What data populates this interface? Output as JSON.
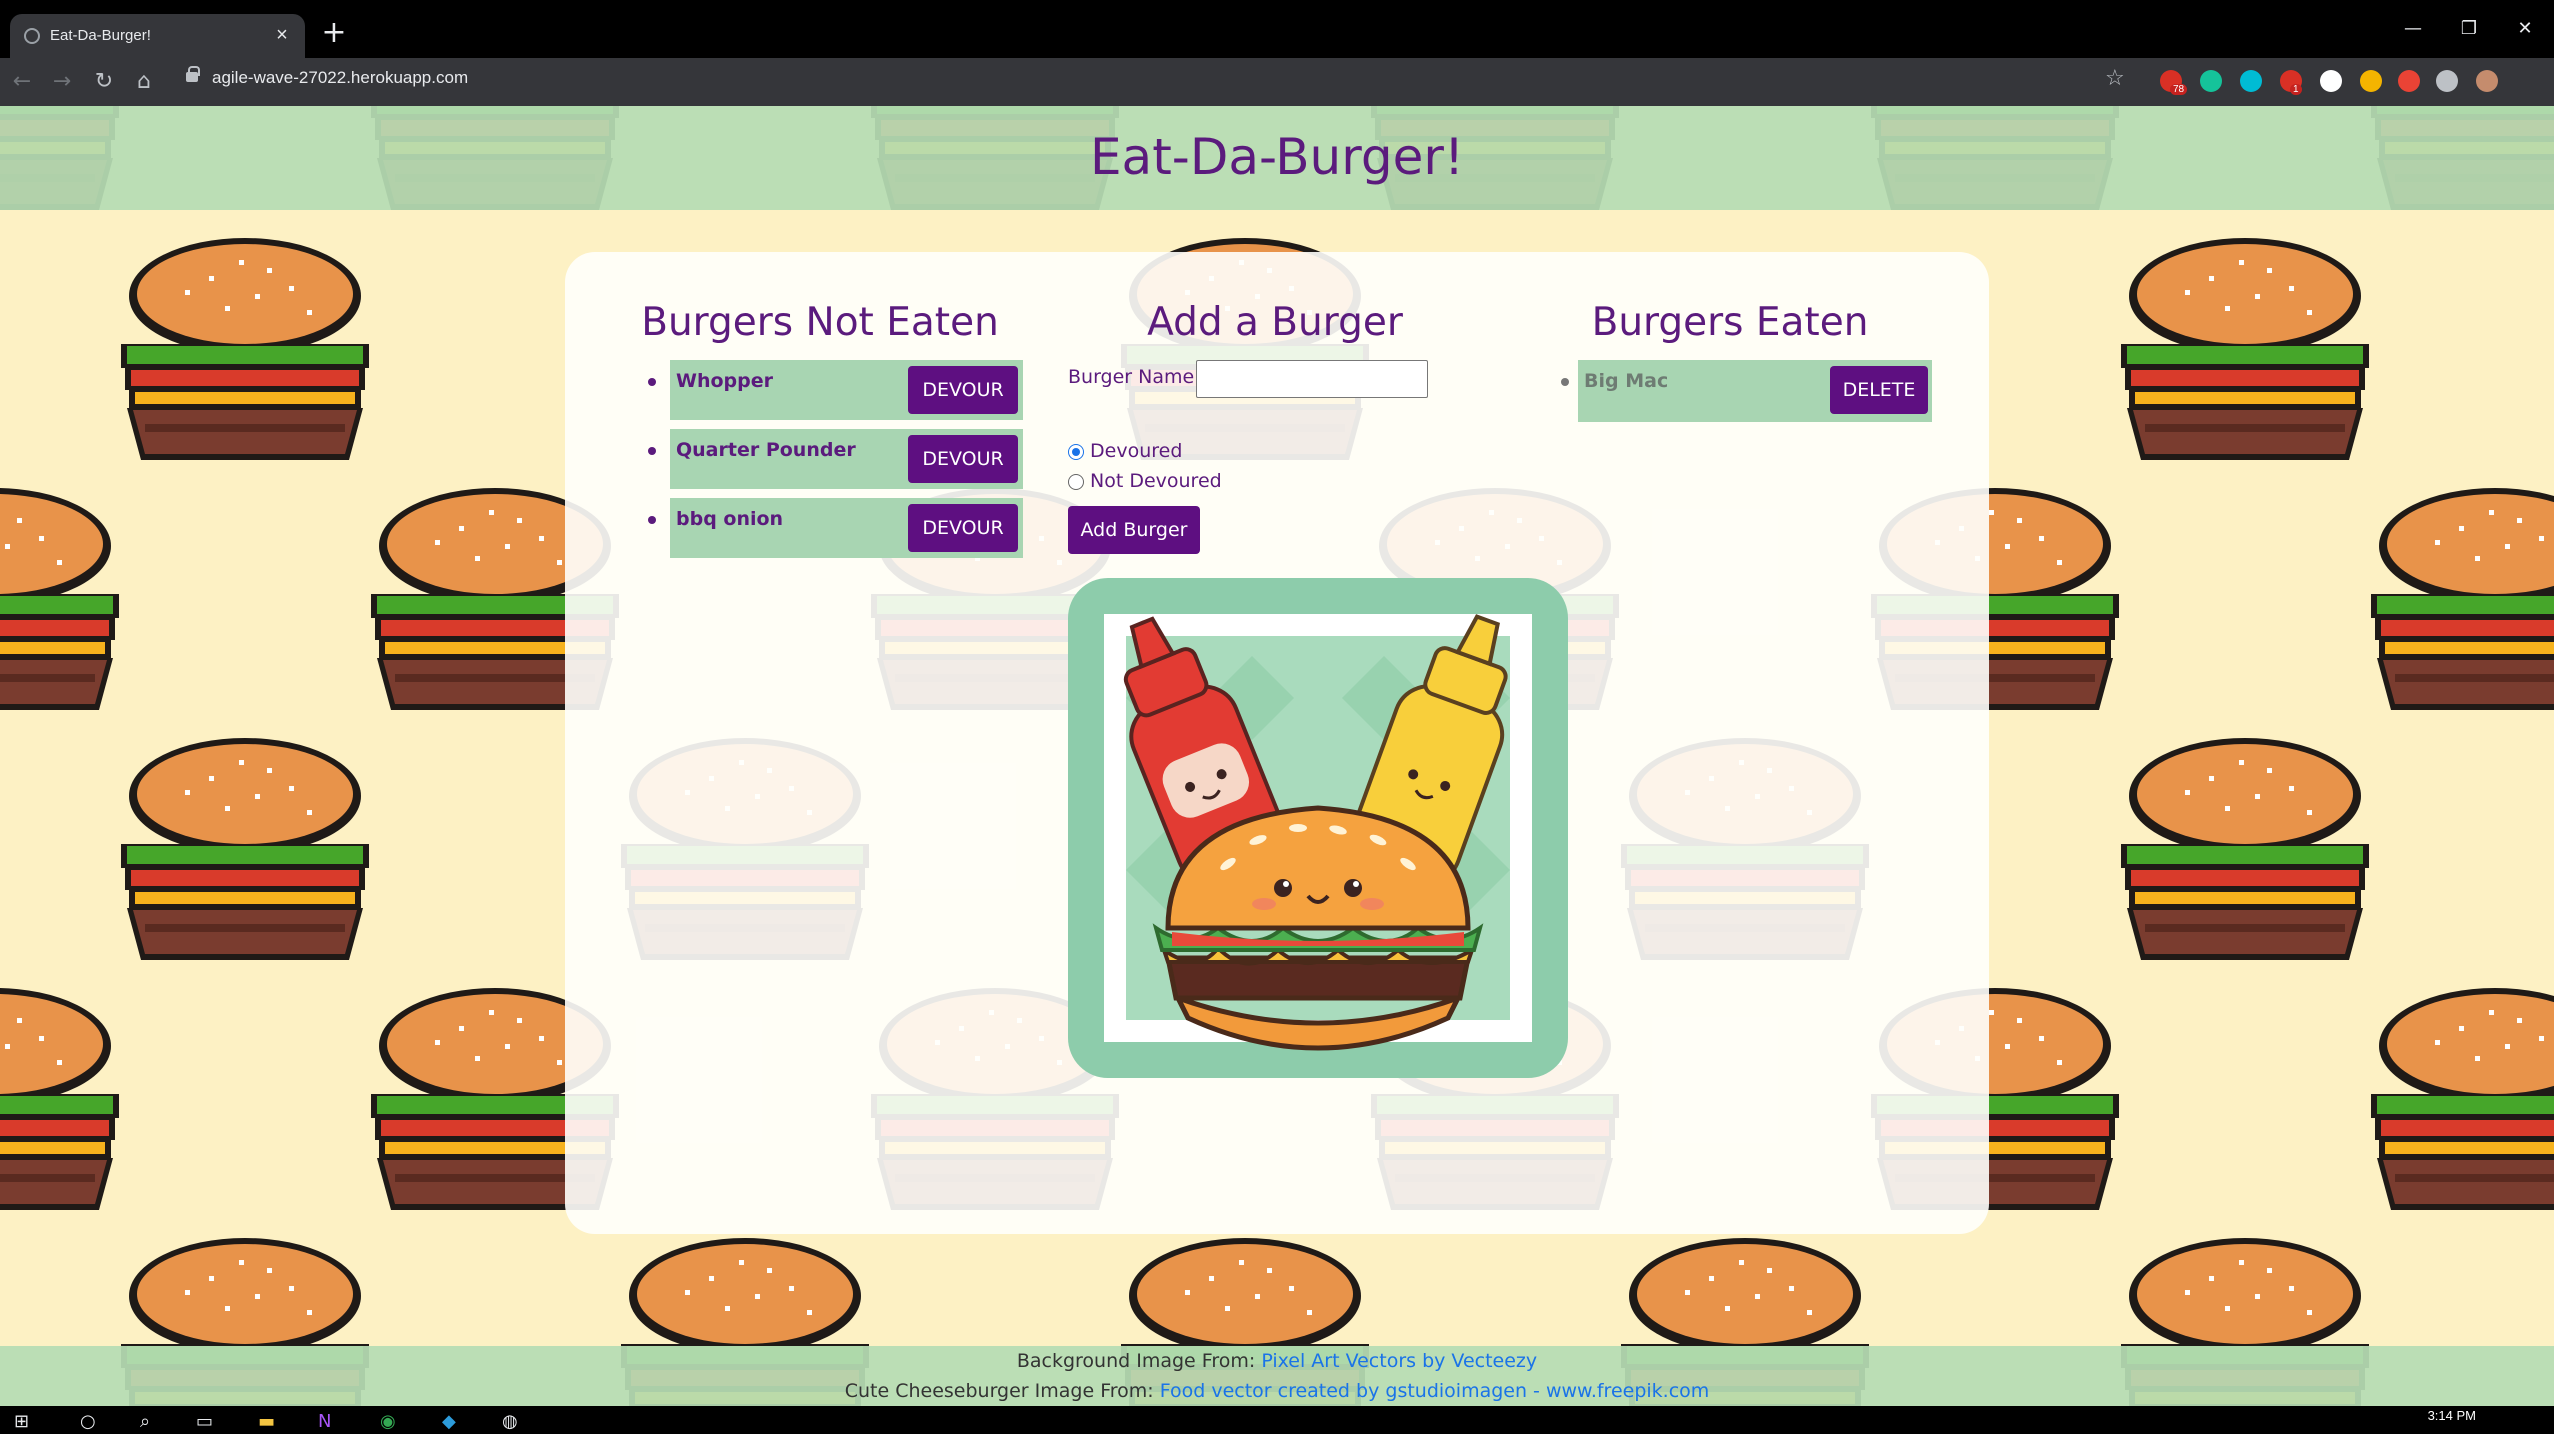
{
  "browser": {
    "tab_title": "Eat-Da-Burger!",
    "url": "agile-wave-27022.herokuapp.com",
    "extensions": [
      {
        "name": "ext-red-badge",
        "badge": "78",
        "color": "#d93025"
      },
      {
        "name": "grammarly-icon",
        "color": "#15c39a"
      },
      {
        "name": "ext-m-icon",
        "color": "#00bcd4"
      },
      {
        "name": "ext-calendar-icon",
        "badge": "1",
        "color": "#d93025"
      },
      {
        "name": "ext-white-circle-icon",
        "color": "#ffffff"
      },
      {
        "name": "ext-bottle-icon",
        "color": "#f4b400"
      },
      {
        "name": "ext-camera-icon",
        "color": "#ea4335"
      },
      {
        "name": "puzzle-extensions-icon",
        "color": "#bdc1c6"
      },
      {
        "name": "profile-avatar",
        "color": "#c58c6d"
      }
    ]
  },
  "page": {
    "title": "Eat-Da-Burger!",
    "not_eaten": {
      "title": "Burgers Not Eaten",
      "items": [
        {
          "name": "Whopper",
          "button": "DEVOUR"
        },
        {
          "name": "Quarter Pounder",
          "button": "DEVOUR"
        },
        {
          "name": "bbq onion",
          "button": "DEVOUR"
        }
      ]
    },
    "add_form": {
      "title": "Add a Burger",
      "name_label": "Burger Name:",
      "name_value": "",
      "radio_devoured": "Devoured",
      "radio_not_devoured": "Not Devoured",
      "selected": "Devoured",
      "submit": "Add Burger"
    },
    "eaten": {
      "title": "Burgers Eaten",
      "items": [
        {
          "name": "Big Mac",
          "button": "DELETE"
        }
      ]
    },
    "footer": {
      "bg_prefix": "Background Image From:",
      "bg_link": "Pixel Art Vectors by Vecteezy",
      "img_prefix": "Cute Cheeseburger Image From:",
      "img_link": "Food vector created by gstudioimagen - www.freepik.com"
    }
  },
  "colors": {
    "accent_purple": "#5e0f81",
    "row_green": "#a8d5b2",
    "band_green": "#b6ddb4",
    "page_bg": "#fdf1c4"
  },
  "taskbar": {
    "time": "3:14 PM"
  }
}
